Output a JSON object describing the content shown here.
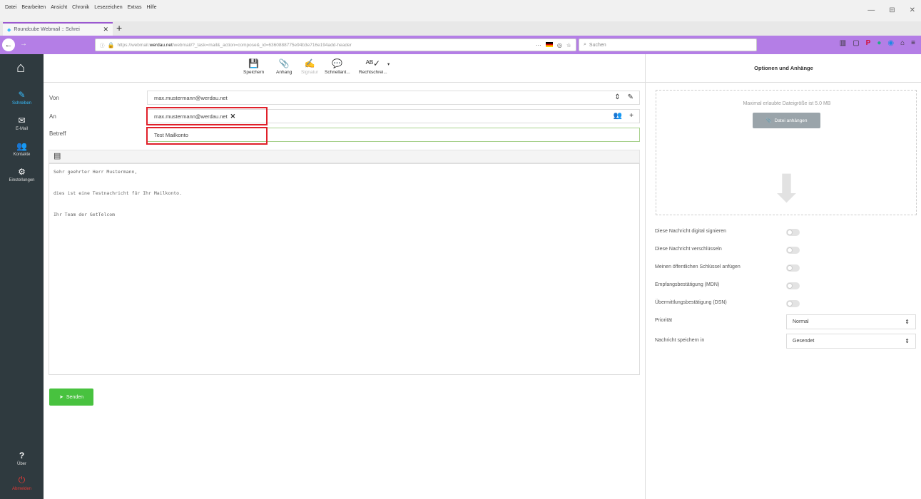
{
  "browser": {
    "menus": [
      "Datei",
      "Bearbeiten",
      "Ansicht",
      "Chronik",
      "Lesezeichen",
      "Extras",
      "Hilfe"
    ],
    "window_controls": [
      "—",
      "⊟",
      "✕"
    ],
    "tab_title": "Roundcube Webmail :: Schrei",
    "url_prefix": "https://webmail.",
    "url_host": "werdau.net",
    "url_rest": "/webmail/?_task=mail&_action=compose&_id=6360888775e94b3e716e194add-header",
    "search_placeholder": "Suchen"
  },
  "sidebar": {
    "items": [
      {
        "label": "Schreiben",
        "icon": "compose-icon"
      },
      {
        "label": "E-Mail",
        "icon": "mail-icon"
      },
      {
        "label": "Kontakte",
        "icon": "contacts-icon"
      },
      {
        "label": "Einstellungen",
        "icon": "gear-icon"
      },
      {
        "label": "Über",
        "icon": "help-icon"
      },
      {
        "label": "Abmelden",
        "icon": "power-icon"
      }
    ]
  },
  "toolbar": {
    "save": "Speichern",
    "attach": "Anhang",
    "signature": "Signatur",
    "responses": "Schnellant...",
    "spell": "Rechtschrei..."
  },
  "compose": {
    "from_label": "Von",
    "from_value": "max.mustermann@werdau.net",
    "to_label": "An",
    "to_recipient": "max.mustermann@werdau.net",
    "subject_label": "Betreff",
    "subject_value": "Test Mailkonto",
    "body_lines": [
      "Sehr geehrter Herr Mustermann,",
      "dies ist eine Testnachricht für Ihr Mailkonto.",
      "Ihr Team der GetTelcom"
    ],
    "send": "Senden"
  },
  "options": {
    "title": "Optionen und Anhänge",
    "max_size": "Maximal erlaubte Dateigröße ist 5.0 MB",
    "attach_button": "Datei anhängen",
    "toggles": [
      "Diese Nachricht digital signieren",
      "Diese Nachricht verschlüsseln",
      "Meinen öffentlichen Schlüssel anfügen",
      "Empfangsbestätigung (MDN)",
      "Übermittlungsbestätigung (DSN)"
    ],
    "priority_label": "Priorität",
    "priority_value": "Normal",
    "save_in_label": "Nachricht speichern in",
    "save_in_value": "Gesendet"
  },
  "colors": {
    "browser_accent": "#b47ee6",
    "send_button": "#48c23f",
    "highlight_box": "#e0202a",
    "app_sidebar": "#2f3a3f"
  }
}
